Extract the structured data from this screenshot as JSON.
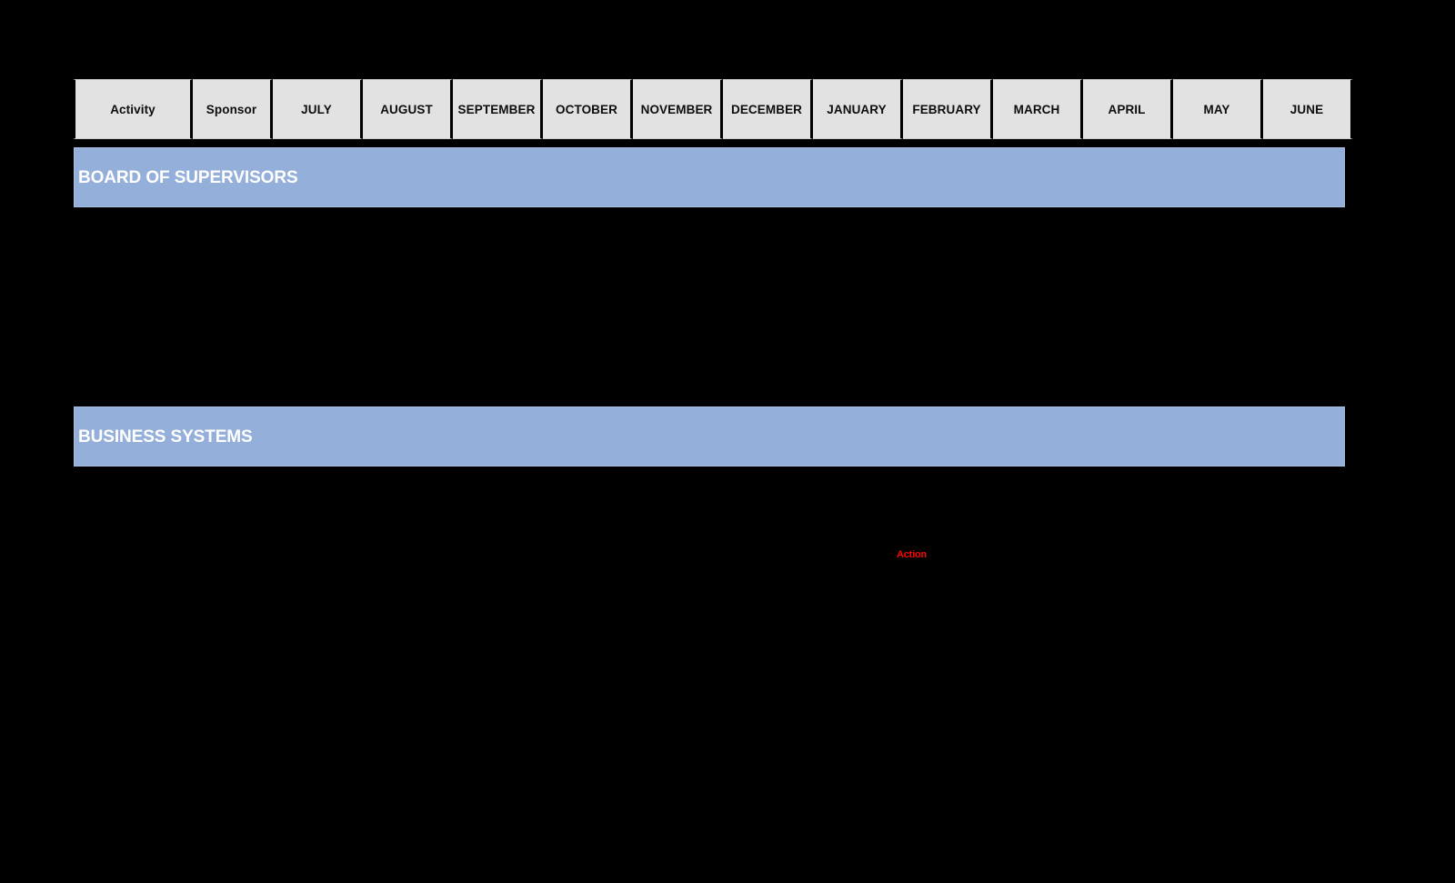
{
  "page": {
    "background_color": "#000000",
    "document_type": "annual-activity-calendar-table"
  },
  "table": {
    "columns": [
      {
        "key": "activity",
        "label": "Activity",
        "type": "label"
      },
      {
        "key": "sponsor",
        "label": "Sponsor",
        "type": "label"
      },
      {
        "key": "july",
        "label": "JULY",
        "type": "month"
      },
      {
        "key": "august",
        "label": "AUGUST",
        "type": "month"
      },
      {
        "key": "september",
        "label": "SEPTEMBER",
        "type": "month"
      },
      {
        "key": "october",
        "label": "OCTOBER",
        "type": "month"
      },
      {
        "key": "november",
        "label": "NOVEMBER",
        "type": "month"
      },
      {
        "key": "december",
        "label": "DECEMBER",
        "type": "month"
      },
      {
        "key": "january",
        "label": "JANUARY",
        "type": "month"
      },
      {
        "key": "february",
        "label": "FEBRUARY",
        "type": "month"
      },
      {
        "key": "march",
        "label": "MARCH",
        "type": "month"
      },
      {
        "key": "april",
        "label": "APRIL",
        "type": "month"
      },
      {
        "key": "may",
        "label": "MAY",
        "type": "month"
      },
      {
        "key": "june",
        "label": "JUNE",
        "type": "month"
      }
    ],
    "header_background": "#e2e2e2",
    "header_text_color": "#0d0d0d",
    "gridline_color": "#000000"
  },
  "sections": [
    {
      "id": "board-of-supervisors",
      "label": "BOARD OF SUPERVISORS",
      "band_color": "#94b0da",
      "label_color": "#ffffff",
      "rows": []
    },
    {
      "id": "business-systems",
      "label": "BUSINESS SYSTEMS",
      "band_color": "#94b0da",
      "label_color": "#ffffff",
      "rows": []
    }
  ],
  "annotations": [
    {
      "id": "action-marker",
      "text": "Action",
      "color": "#fb0505",
      "column": "february"
    }
  ]
}
